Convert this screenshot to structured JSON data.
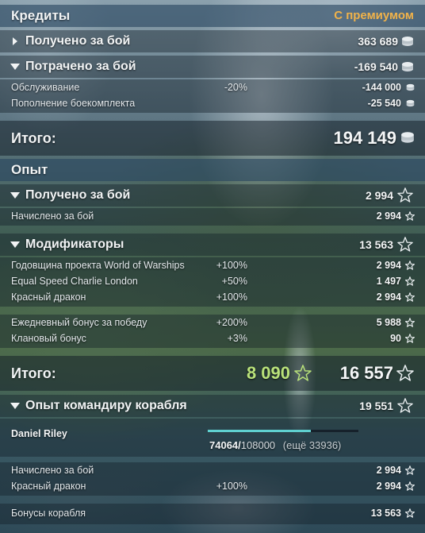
{
  "credits": {
    "header": "Кредиты",
    "premium_label": "С премиумом",
    "received": {
      "label": "Получено за бой",
      "value": "363 689"
    },
    "spent": {
      "label": "Потрачено за бой",
      "value": "-169 540"
    },
    "items": [
      {
        "label": "Обслуживание",
        "pct": "-20%",
        "value": "-144 000"
      },
      {
        "label": "Пополнение боекомплекта",
        "pct": "",
        "value": "-25 540"
      }
    ],
    "total": {
      "label": "Итого:",
      "value": "194 149"
    }
  },
  "experience": {
    "header": "Опыт",
    "received": {
      "label": "Получено за бой",
      "value": "2 994"
    },
    "received_items": [
      {
        "label": "Начислено за бой",
        "value": "2 994"
      }
    ],
    "modifiers": {
      "label": "Модификаторы",
      "value": "13 563"
    },
    "modifier_items": [
      {
        "label": "Годовщина проекта World of Warships",
        "pct": "+100%",
        "value": "2 994"
      },
      {
        "label": "Equal Speed Charlie London",
        "pct": "+50%",
        "value": "1 497"
      },
      {
        "label": "Красный дракон",
        "pct": "+100%",
        "value": "2 994"
      },
      {
        "label": "Ежедневный бонус за победу",
        "pct": "+200%",
        "value": "5 988"
      },
      {
        "label": "Клановый бонус",
        "pct": "+3%",
        "value": "90"
      }
    ],
    "total": {
      "label": "Итого:",
      "green_value": "8 090",
      "value": "16 557"
    }
  },
  "commander": {
    "label": "Опыт командиру корабля",
    "value": "19 551",
    "name": "Daniel Riley",
    "progress_current": "74064",
    "progress_sep": "/",
    "progress_max": "108000",
    "progress_remaining": "(ещё 33936)",
    "progress_fraction": 0.686,
    "items": [
      {
        "label": "Начислено за бой",
        "pct": "",
        "value": "2 994"
      },
      {
        "label": "Красный дракон",
        "pct": "+100%",
        "value": "2 994"
      }
    ],
    "bonus": {
      "label": "Бонусы корабля",
      "value": "13 563"
    }
  },
  "colors": {
    "premium": "#f0b24a",
    "green": "#b9e27a",
    "bar": "#5fd0d0"
  }
}
